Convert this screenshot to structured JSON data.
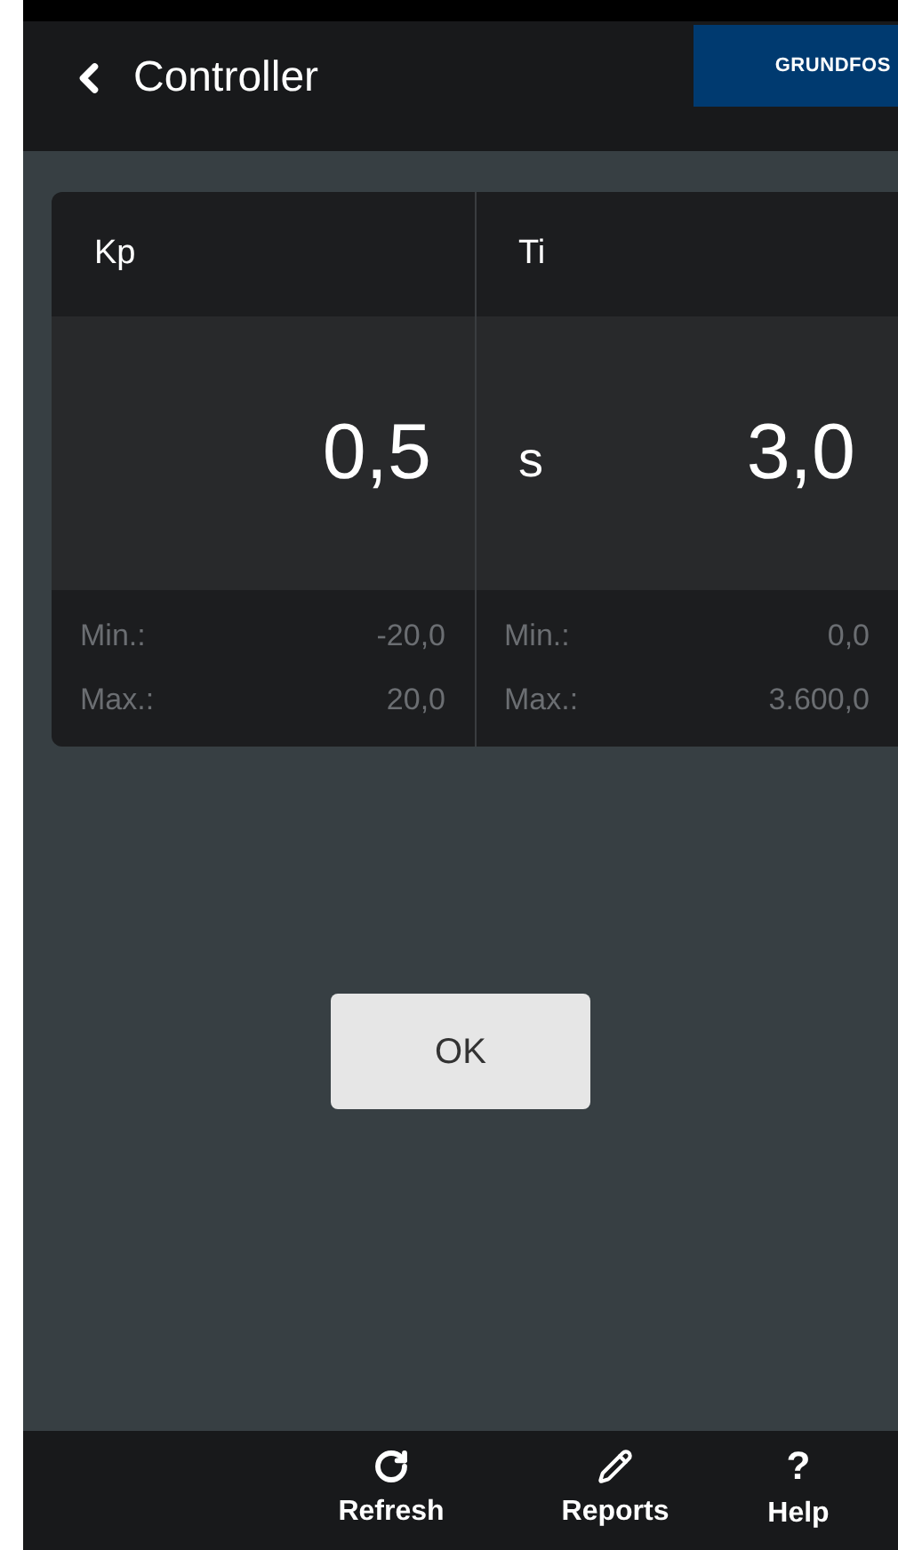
{
  "header": {
    "title": "Controller",
    "logo": "GRUNDFOS"
  },
  "parameters": [
    {
      "name": "Kp",
      "value": "0,5",
      "min_label": "Min.:",
      "min": "-20,0",
      "max_label": "Max.:",
      "max": "20,0"
    },
    {
      "name": "Ti",
      "unit": "s",
      "value": "3,0",
      "min_label": "Min.:",
      "min": "0,0",
      "max_label": "Max.:",
      "max": "3.600,0"
    }
  ],
  "ok_button": "OK",
  "toolbar": [
    {
      "kind": "refresh",
      "label": "Refresh"
    },
    {
      "kind": "reports",
      "label": "Reports"
    },
    {
      "kind": "help",
      "label": "Help",
      "glyph": "?"
    }
  ]
}
